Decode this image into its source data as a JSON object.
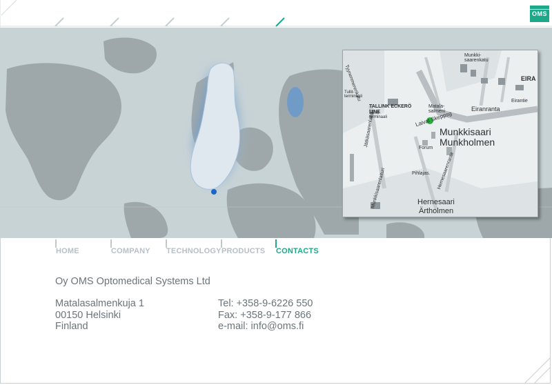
{
  "brand": {
    "logo_text": "OMS",
    "accent_color": "#1ea88a"
  },
  "nav": {
    "items": [
      {
        "label": "HOME"
      },
      {
        "label": "COMPANY"
      },
      {
        "label": "TECHNOLOGY"
      },
      {
        "label": "PRODUCTS"
      },
      {
        "label": "CONTACTS",
        "active": true
      }
    ]
  },
  "map": {
    "inset_labels": [
      "TALLINK ECKERÖ LINE",
      "Munkkisaari",
      "Munkholmen",
      "Hernesaari",
      "Ärtholmen",
      "Eiranranta",
      "Matala-salmeni",
      "Laivat Skeppsg",
      "EIRA",
      "Munkki-saarenkatu",
      "Tullit-terminaali",
      "Länsi-terminaali",
      "Jätkäsaarenlaituri",
      "Munkkisaarenlaituri",
      "Hernesaarenranta",
      "Pihlajas.",
      "Forum",
      "Tyynenmerenkatu",
      "Eirantie"
    ]
  },
  "contacts": {
    "company": "Oy OMS Optomedical Systems Ltd",
    "address": [
      "Matalasalmenkuja 1",
      "00150 Helsinki",
      "Finland"
    ],
    "tel": "Tel: +358-9-6226 550",
    "fax": "Fax: +358-9-177 866",
    "email": "e-mail: info@oms.fi"
  }
}
